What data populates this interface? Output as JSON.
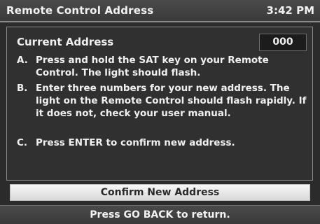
{
  "header": {
    "title": "Remote Control Address",
    "time": "3:42 PM"
  },
  "current_address": {
    "label": "Current Address",
    "value": "000"
  },
  "steps": [
    {
      "letter": "A.",
      "text": "Press and hold the SAT key on your Remote Control. The light should flash."
    },
    {
      "letter": "B.",
      "text": "Enter three numbers for your new address. The light on the Remote Control should flash rapidly. If it does not, check your user manual."
    },
    {
      "letter": "C.",
      "text": "Press ENTER to confirm new address."
    }
  ],
  "confirm_button": {
    "label": "Confirm New Address"
  },
  "footer": {
    "hint": "Press GO BACK to return."
  }
}
